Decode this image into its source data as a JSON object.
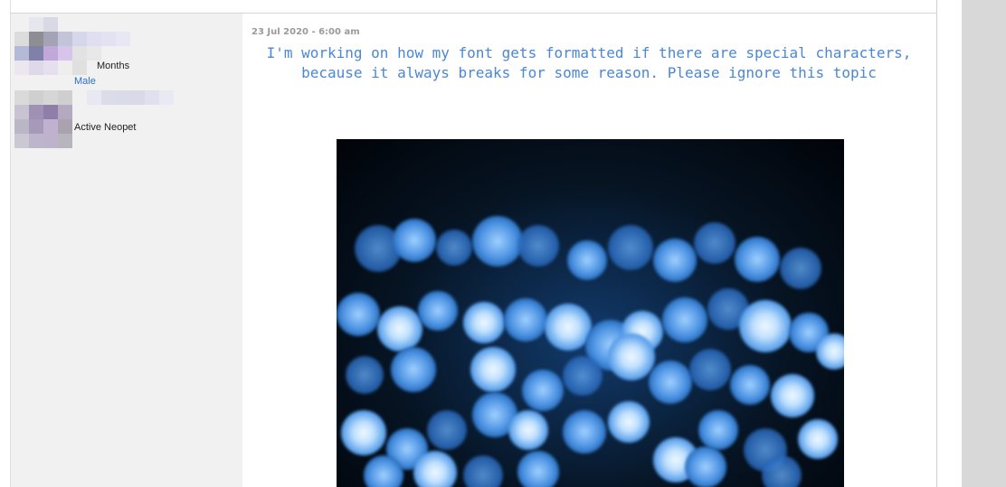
{
  "profile": {
    "tenure_label": "Months",
    "gender": "Male",
    "status": "Active Neopet"
  },
  "post": {
    "date": "23 Jul 2020 - 6:00 am",
    "message": "I'm working on how my font gets formatted if there are special characters, because it always breaks for some reason. Please ignore this topic",
    "image_description_icon": "blue-bokeh-lights-image"
  },
  "colors": {
    "message_text": "#4a87d4",
    "gender_text": "#2a6fd0",
    "sidebar_bg": "#f1f1f1",
    "gutter_bg": "#d8d8d8"
  }
}
